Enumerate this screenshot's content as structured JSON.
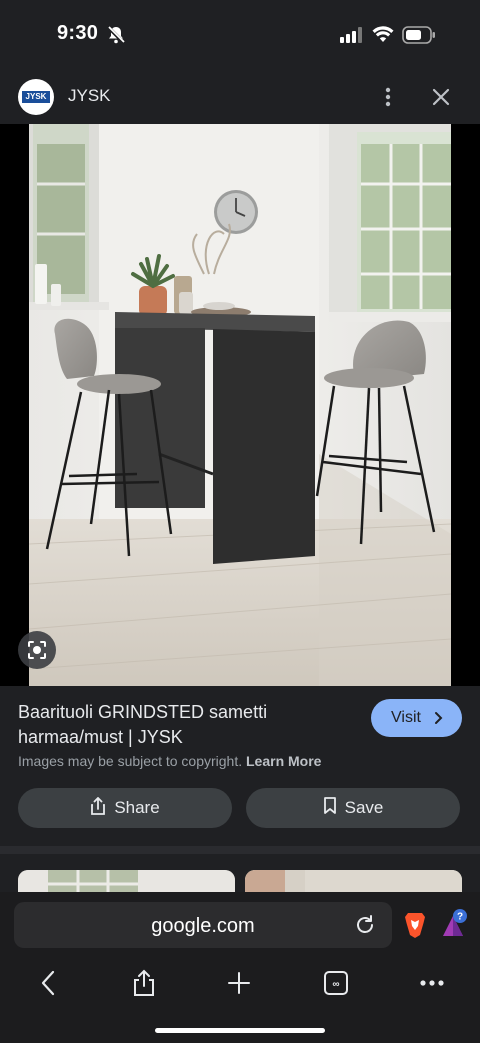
{
  "status_bar": {
    "time": "9:30"
  },
  "header": {
    "site_name": "JYSK",
    "logo_text": "JYSK"
  },
  "result": {
    "title": "Baarituoli GRINDSTED sametti harmaa/must | JYSK",
    "visit_label": "Visit",
    "copyright_text": "Images may be subject to copyright.",
    "learn_more_label": "Learn More",
    "share_label": "Share",
    "save_label": "Save"
  },
  "browser": {
    "url": "google.com"
  },
  "colors": {
    "accent": "#8ab4f8",
    "background": "#1f2023",
    "button_bg": "#3c4043"
  },
  "icons": [
    "bell-slash-icon",
    "signal-icon",
    "wifi-icon",
    "battery-icon",
    "more-vert-icon",
    "close-icon",
    "lens-icon",
    "chevron-right-icon",
    "share-icon",
    "bookmark-icon",
    "reload-icon",
    "brave-icon",
    "rewards-icon",
    "back-icon",
    "share-sheet-icon",
    "new-tab-icon",
    "tabs-icon",
    "more-icon"
  ]
}
